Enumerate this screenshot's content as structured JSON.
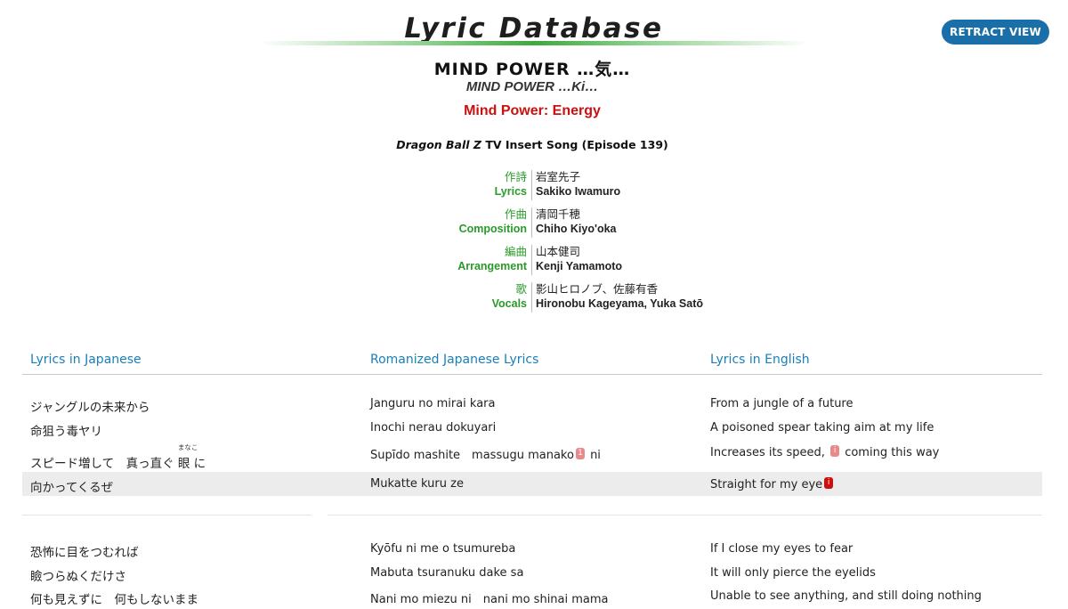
{
  "header": {
    "site_title": "Lyric Database",
    "retract_label": "RETRACT VIEW"
  },
  "song": {
    "title": "MIND POWER …気…",
    "romaji": "MIND POWER …Ki…",
    "english": "Mind Power: Energy",
    "source_italic": "Dragon Ball Z",
    "source_rest": " TV Insert Song (Episode 139)"
  },
  "credits": [
    {
      "label_jp": "作詩",
      "label_en": "Lyrics",
      "value_jp": "岩室先子",
      "value_en": "Sakiko Iwamuro"
    },
    {
      "label_jp": "作曲",
      "label_en": "Composition",
      "value_jp": "清岡千穂",
      "value_en": "Chiho Kiyo'oka"
    },
    {
      "label_jp": "編曲",
      "label_en": "Arrangement",
      "value_jp": "山本健司",
      "value_en": "Kenji Yamamoto"
    },
    {
      "label_jp": "歌",
      "label_en": "Vocals",
      "value_jp": "影山ヒロノブ、佐藤有香",
      "value_en": "Hironobu Kageyama, Yuka Satō"
    }
  ],
  "lyrics_header": {
    "japanese": "Lyrics in Japanese",
    "romanized": "Romanized Japanese Lyrics",
    "english": "Lyrics in English"
  },
  "stanza1": [
    {
      "jp": "ジャングルの未来から",
      "romaji": "Janguru no mirai kara",
      "en": "From a jungle of a future"
    },
    {
      "jp": "命狙う毒ヤリ",
      "romaji": "Inochi nerau dokuyari",
      "en": "A poisoned spear taking aim at my life"
    },
    {
      "jp_before": "スピード増して　真っ直ぐ ",
      "jp_ruby_base": "眼",
      "jp_ruby_text": "まなこ",
      "jp_after": " に",
      "romaji_before": "Supīdo mashite　massugu manako",
      "romaji_note": "1",
      "romaji_after": " ni",
      "en_before": "Increases its speed, ",
      "en_note": "i",
      "en_after": " coming this way"
    },
    {
      "jp": "向かってくるぜ",
      "romaji": "Mukatte kuru ze",
      "en_before": "Straight for my eye",
      "en_note": "i"
    }
  ],
  "stanza2": [
    {
      "jp": "恐怖に目をつむれば",
      "romaji": "Kyōfu ni me o tsumureba",
      "en": "If I close my eyes to fear"
    },
    {
      "jp": "瞼つらぬくだけさ",
      "romaji": "Mabuta tsuranuku dake sa",
      "en": "It will only pierce the eyelids"
    },
    {
      "jp": "何も見えずに　何もしないまま",
      "romaji": "Nani mo miezu ni　nani mo shinai mama",
      "en": "Unable to see anything, and still doing nothing"
    }
  ],
  "colors": {
    "accent_blue": "#1a6fa8",
    "credit_green": "#2a9a2a",
    "english_red": "#cc1010",
    "highlight_row": "#ececec"
  }
}
